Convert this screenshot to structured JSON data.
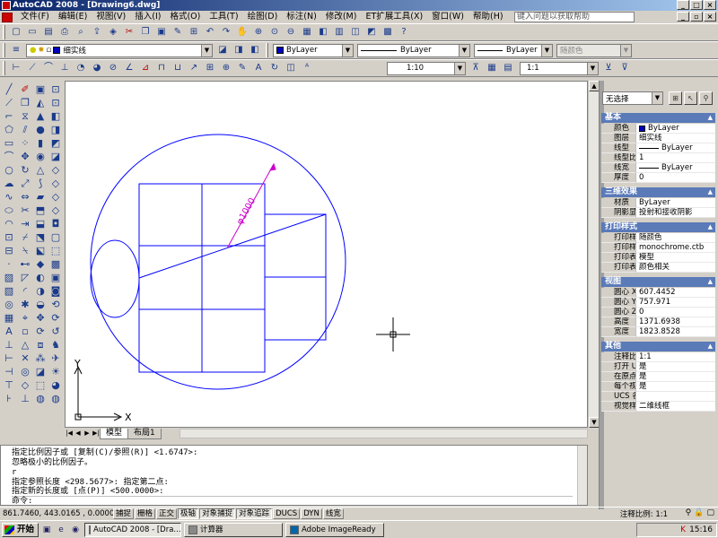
{
  "window": {
    "title": "AutoCAD 2008 - [Drawing6.dwg]"
  },
  "menu": {
    "items": [
      "文件(F)",
      "编辑(E)",
      "视图(V)",
      "插入(I)",
      "格式(O)",
      "工具(T)",
      "绘图(D)",
      "标注(N)",
      "修改(M)",
      "ET扩展工具(X)",
      "窗口(W)",
      "帮助(H)"
    ],
    "help_placeholder": "键入问题以获取帮助"
  },
  "toolbar2": {
    "layer": "细实线",
    "color": "ByLayer",
    "linetype": "ByLayer",
    "lineweight": "ByLayer",
    "plotstyle": "随颜色"
  },
  "toolbar3": {
    "scale1": "1:10",
    "scale2": "1:1"
  },
  "drawing": {
    "dimension_text": "φ1000",
    "ucs_x": "X",
    "ucs_y": "Y"
  },
  "tabs": [
    "模型",
    "布局1"
  ],
  "properties": {
    "selection": "无选择",
    "sections": [
      {
        "title": "基本",
        "rows": [
          {
            "key": "颜色",
            "value": "ByLayer",
            "kind": "color"
          },
          {
            "key": "图层",
            "value": "细实线",
            "kind": "text"
          },
          {
            "key": "线型",
            "value": "ByLayer",
            "kind": "line"
          },
          {
            "key": "线型比例",
            "value": "1",
            "kind": "text"
          },
          {
            "key": "线宽",
            "value": "ByLayer",
            "kind": "line"
          },
          {
            "key": "厚度",
            "value": "0",
            "kind": "text"
          }
        ]
      },
      {
        "title": "三维效果",
        "rows": [
          {
            "key": "材质",
            "value": "ByLayer",
            "kind": "text"
          },
          {
            "key": "阴影显示",
            "value": "投射和接收阴影",
            "kind": "text"
          }
        ]
      },
      {
        "title": "打印样式",
        "rows": [
          {
            "key": "打印样式",
            "value": "随颜色",
            "kind": "text"
          },
          {
            "key": "打印样...",
            "value": "monochrome.ctb",
            "kind": "text"
          },
          {
            "key": "打印表...",
            "value": "模型",
            "kind": "text"
          },
          {
            "key": "打印表...",
            "value": "颜色相关",
            "kind": "text"
          }
        ]
      },
      {
        "title": "视图",
        "rows": [
          {
            "key": "圆心 X...",
            "value": "607.4452",
            "kind": "text"
          },
          {
            "key": "圆心 Y...",
            "value": "757.971",
            "kind": "text"
          },
          {
            "key": "圆心 Z...",
            "value": "0",
            "kind": "text"
          },
          {
            "key": "高度",
            "value": "1371.6938",
            "kind": "text"
          },
          {
            "key": "宽度",
            "value": "1823.8528",
            "kind": "text"
          }
        ]
      },
      {
        "title": "其他",
        "rows": [
          {
            "key": "注释比例",
            "value": "1:1",
            "kind": "text"
          },
          {
            "key": "打开 U...",
            "value": "是",
            "kind": "text"
          },
          {
            "key": "在原点...",
            "value": "是",
            "kind": "text"
          },
          {
            "key": "每个视...",
            "value": "是",
            "kind": "text"
          },
          {
            "key": "UCS 名称",
            "value": "",
            "kind": "text"
          },
          {
            "key": "视觉样式",
            "value": "二维线框",
            "kind": "text"
          }
        ]
      }
    ]
  },
  "command": {
    "lines": [
      "指定比例因子或 [复制(C)/参照(R)] <1.6747>:",
      "忽略极小的比例因子。",
      "r",
      "指定参照长度 <298.5677>:  指定第二点:",
      "指定新的长度或 [点(P)] <500.0000>:"
    ],
    "prompt": "命令:"
  },
  "status": {
    "coords": "861.7460, 443.0165 , 0.0000",
    "buttons": [
      {
        "label": "捕捉",
        "on": false
      },
      {
        "label": "栅格",
        "on": false
      },
      {
        "label": "正交",
        "on": false
      },
      {
        "label": "极轴",
        "on": true
      },
      {
        "label": "对象捕捉",
        "on": true
      },
      {
        "label": "对象追踪",
        "on": true
      },
      {
        "label": "DUCS",
        "on": false
      },
      {
        "label": "DYN",
        "on": false
      },
      {
        "label": "线宽",
        "on": false
      }
    ],
    "annotation_scale": "注释比例: 1:1"
  },
  "taskbar": {
    "start": "开始",
    "tasks": [
      {
        "label": "AutoCAD 2008 - [Dra...",
        "active": true
      },
      {
        "label": "计算器",
        "active": false
      },
      {
        "label": "Adobe ImageReady",
        "active": false
      }
    ],
    "clock": "15:16"
  }
}
